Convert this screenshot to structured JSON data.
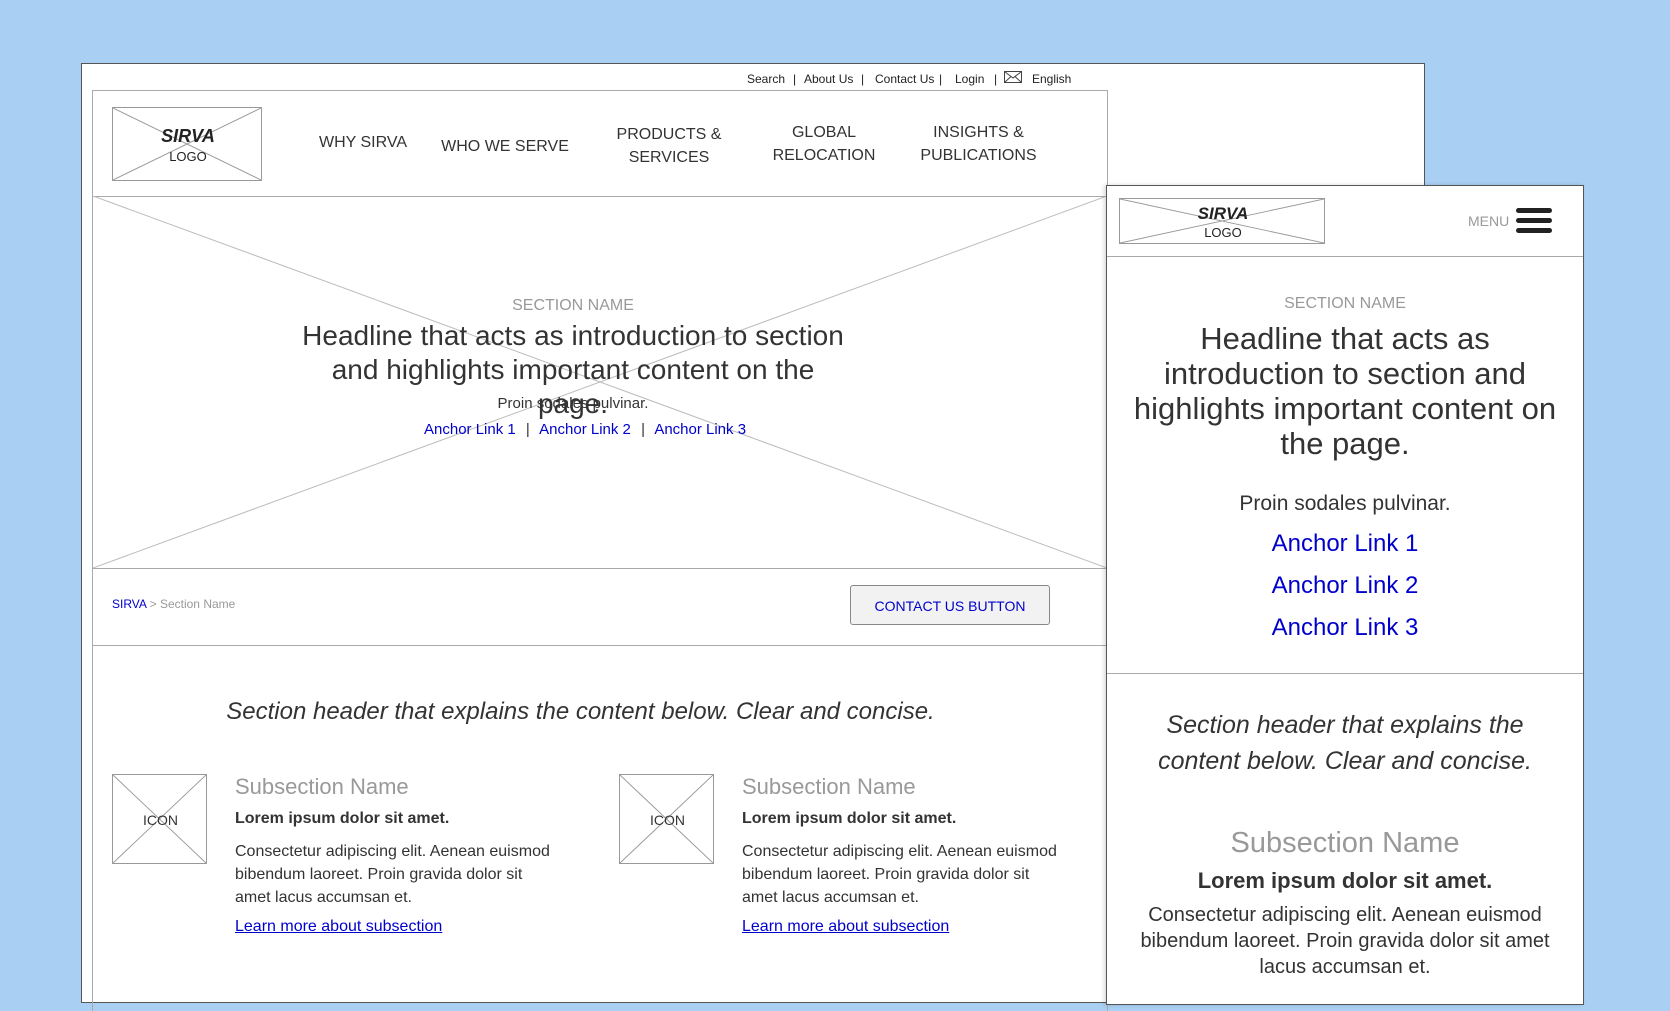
{
  "utility_nav": {
    "items": [
      "Search",
      "About Us",
      "Contact Us",
      "Login"
    ],
    "language": "English",
    "separator": "|"
  },
  "logo": {
    "brand": "SIRVA",
    "label": "LOGO"
  },
  "main_nav": [
    "WHY SIRVA",
    "WHO WE SERVE",
    "PRODUCTS & SERVICES",
    "GLOBAL RELOCATION",
    "INSIGHTS & PUBLICATIONS"
  ],
  "hero": {
    "section_name": "SECTION NAME",
    "headline": "Headline that acts as introduction to section and highlights important content on the page.",
    "subtext": "Proin sodales pulvinar.",
    "anchor_links": [
      "Anchor Link 1",
      "Anchor Link 2",
      "Anchor Link 3"
    ]
  },
  "breadcrumb": {
    "home": "SIRVA",
    "separator": ">",
    "current": "Section Name"
  },
  "contact_button": "CONTACT US BUTTON",
  "section_header": "Section header that explains the content below. Clear and concise.",
  "subsections": [
    {
      "icon_label": "ICON",
      "name": "Subsection Name",
      "lead": "Lorem ipsum dolor sit amet.",
      "body": "Consectetur adipiscing elit. Aenean euismod bibendum laoreet. Proin gravida dolor sit amet lacus accumsan et.",
      "link": "Learn more about subsection"
    },
    {
      "icon_label": "ICON",
      "name": "Subsection Name",
      "lead": "Lorem ipsum dolor sit amet.",
      "body": "Consectetur adipiscing elit. Aenean euismod bibendum laoreet. Proin gravida dolor sit amet lacus accumsan et.",
      "link": "Learn more about subsection"
    }
  ],
  "mobile": {
    "menu_label": "MENU",
    "section_name": "SECTION NAME",
    "headline": "Headline that acts as introduction to section and highlights important content on the page.",
    "subtext": "Proin sodales pulvinar.",
    "anchor_links": [
      "Anchor Link 1",
      "Anchor Link 2",
      "Anchor Link 3"
    ],
    "section_header": "Section header that explains the content below. Clear and concise.",
    "subsection": {
      "name": "Subsection Name",
      "lead": "Lorem ipsum dolor sit amet.",
      "body": "Consectetur adipiscing elit. Aenean euismod bibendum laoreet. Proin gravida dolor sit amet lacus accumsan et."
    }
  },
  "colors": {
    "background": "#a9cff3",
    "link": "#0000cc",
    "muted": "#999999"
  },
  "icons": [
    "envelope-icon",
    "hamburger-menu-icon"
  ]
}
